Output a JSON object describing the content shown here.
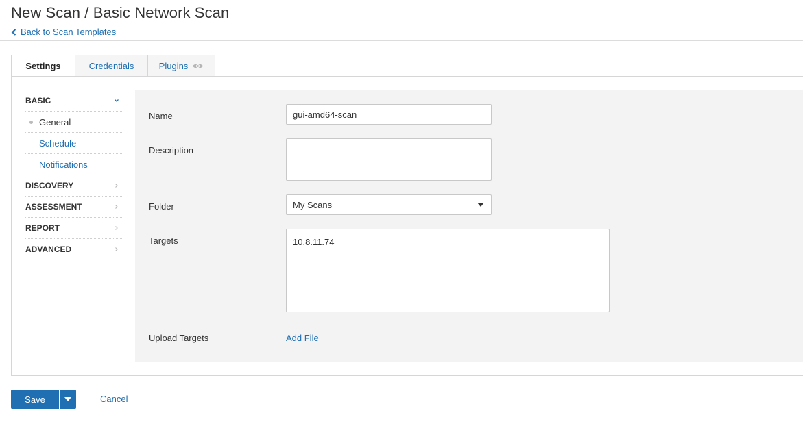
{
  "header": {
    "title": "New Scan / Basic Network Scan",
    "back_link": "Back to Scan Templates"
  },
  "tabs": [
    {
      "label": "Settings",
      "active": true
    },
    {
      "label": "Credentials",
      "active": false
    },
    {
      "label": "Plugins",
      "active": false,
      "icon": "eye-icon"
    }
  ],
  "sidebar": {
    "sections": [
      {
        "label": "BASIC",
        "expanded": true,
        "icon": "chevron-down-icon"
      },
      {
        "label": "DISCOVERY",
        "expanded": false,
        "icon": "chevron-right-icon"
      },
      {
        "label": "ASSESSMENT",
        "expanded": false,
        "icon": "chevron-right-icon"
      },
      {
        "label": "REPORT",
        "expanded": false,
        "icon": "chevron-right-icon"
      },
      {
        "label": "ADVANCED",
        "expanded": false,
        "icon": "chevron-right-icon"
      }
    ],
    "basic_items": [
      {
        "label": "General",
        "active": true
      },
      {
        "label": "Schedule",
        "active": false
      },
      {
        "label": "Notifications",
        "active": false
      }
    ]
  },
  "form": {
    "name": {
      "label": "Name",
      "value": "gui-amd64-scan"
    },
    "description": {
      "label": "Description",
      "value": ""
    },
    "folder": {
      "label": "Folder",
      "value": "My Scans"
    },
    "targets": {
      "label": "Targets",
      "value": "10.8.11.74"
    },
    "upload_targets": {
      "label": "Upload Targets",
      "action": "Add File"
    }
  },
  "footer": {
    "save_label": "Save",
    "cancel_label": "Cancel"
  },
  "colors": {
    "link": "#1f6fb2",
    "primary_button": "#1f6fb2",
    "form_background": "#f3f3f3",
    "border": "#d6d6d6"
  }
}
